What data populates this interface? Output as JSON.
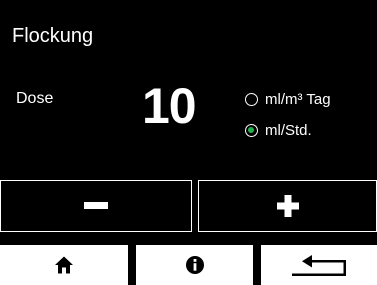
{
  "header": {
    "title": "Flockung"
  },
  "dose": {
    "label": "Dose",
    "value": "10"
  },
  "units": {
    "options": [
      {
        "label": "ml/m³ Tag",
        "selected": false
      },
      {
        "label": "ml/Std.",
        "selected": true
      }
    ],
    "selected_color": "#21b24b"
  },
  "controls": {
    "decrement_icon": "minus-icon",
    "increment_icon": "plus-icon"
  },
  "navigation": {
    "home_icon": "home-icon",
    "info_icon": "info-icon",
    "back_icon": "return-arrow-icon"
  }
}
